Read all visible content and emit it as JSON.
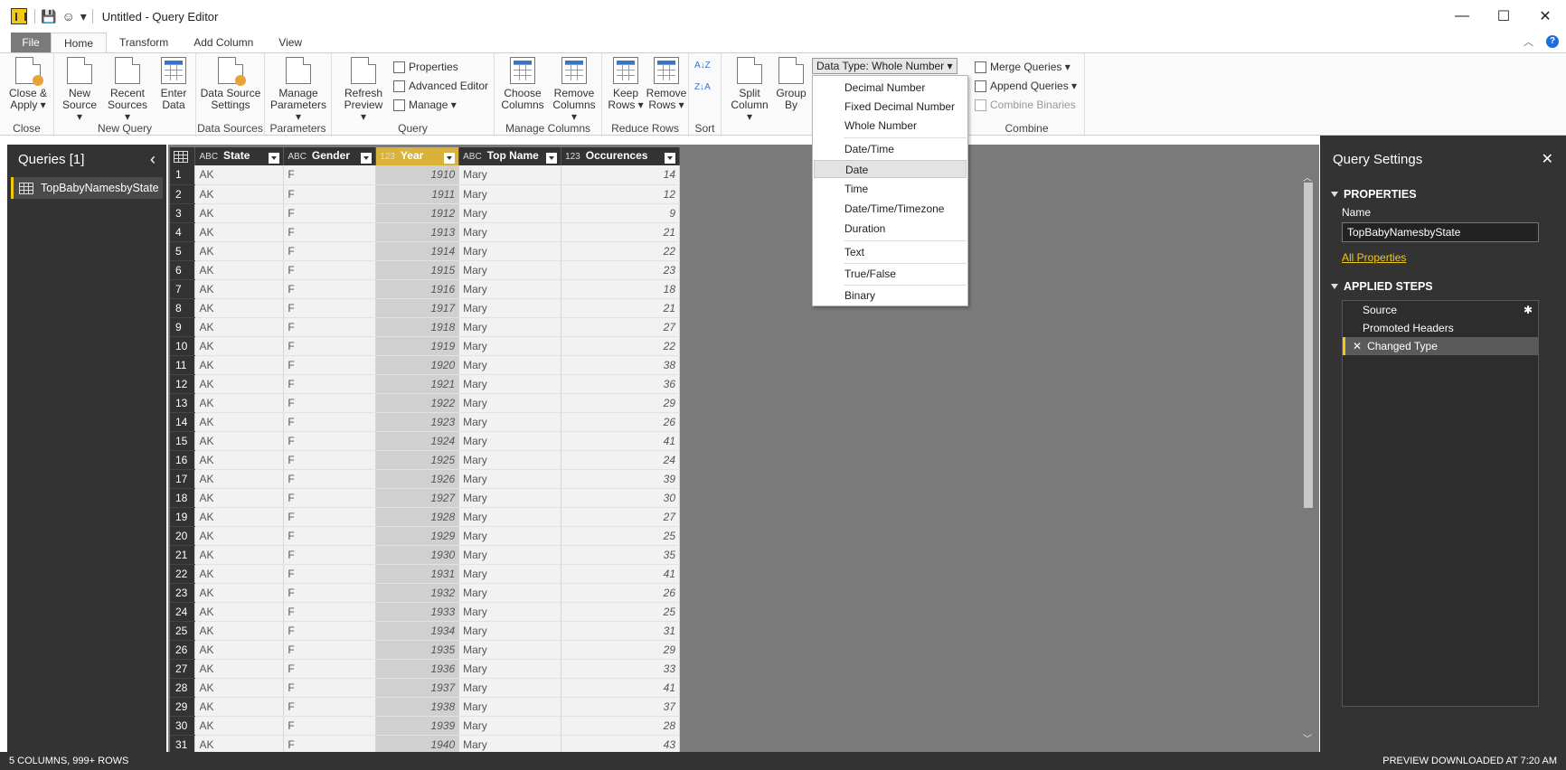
{
  "window": {
    "title": "Untitled - Query Editor",
    "minimize": "—",
    "maximize": "☐",
    "close": "✕"
  },
  "tabs": [
    {
      "label": "File"
    },
    {
      "label": "Home"
    },
    {
      "label": "Transform"
    },
    {
      "label": "Add Column"
    },
    {
      "label": "View"
    }
  ],
  "ribbon": {
    "close_group": {
      "label": "Close",
      "close_apply": "Close & Apply ▾"
    },
    "new_query": {
      "label": "New Query",
      "new_source": "New Source ▾",
      "recent_sources": "Recent Sources ▾",
      "enter_data": "Enter Data"
    },
    "data_sources": {
      "label": "Data Sources",
      "settings": "Data Source Settings"
    },
    "parameters": {
      "label": "Parameters",
      "manage": "Manage Parameters ▾"
    },
    "query": {
      "label": "Query",
      "refresh": "Refresh Preview ▾",
      "properties": "Properties",
      "advanced": "Advanced Editor",
      "manage": "Manage ▾"
    },
    "manage_columns": {
      "label": "Manage Columns",
      "choose": "Choose Columns",
      "remove": "Remove Columns ▾"
    },
    "reduce_rows": {
      "label": "Reduce Rows",
      "keep": "Keep Rows ▾",
      "remove": "Remove Rows ▾"
    },
    "sort": {
      "label": "Sort",
      "asc": "A↓Z",
      "desc": "Z↓A"
    },
    "transform": {
      "split": "Split Column ▾",
      "group": "Group By",
      "data_type": "Data Type: Whole Number ▾"
    },
    "combine": {
      "label": "Combine",
      "merge": "Merge Queries ▾",
      "append": "Append Queries ▾",
      "binaries": "Combine Binaries"
    }
  },
  "dtype_menu": [
    "Decimal Number",
    "Fixed Decimal Number",
    "Whole Number",
    "Date/Time",
    "Date",
    "Time",
    "Date/Time/Timezone",
    "Duration",
    "Text",
    "True/False",
    "Binary"
  ],
  "queries": {
    "title": "Queries [1]",
    "collapse": "‹",
    "items": [
      "TopBabyNamesbyState"
    ]
  },
  "table": {
    "columns": [
      {
        "type": "ABC",
        "name": "State"
      },
      {
        "type": "ABC",
        "name": "Gender"
      },
      {
        "type": "123",
        "name": "Year"
      },
      {
        "type": "ABC",
        "name": "Top Name"
      },
      {
        "type": "123",
        "name": "Occurences"
      }
    ],
    "rows": [
      [
        "1",
        "AK",
        "F",
        "1910",
        "Mary",
        "14"
      ],
      [
        "2",
        "AK",
        "F",
        "1911",
        "Mary",
        "12"
      ],
      [
        "3",
        "AK",
        "F",
        "1912",
        "Mary",
        "9"
      ],
      [
        "4",
        "AK",
        "F",
        "1913",
        "Mary",
        "21"
      ],
      [
        "5",
        "AK",
        "F",
        "1914",
        "Mary",
        "22"
      ],
      [
        "6",
        "AK",
        "F",
        "1915",
        "Mary",
        "23"
      ],
      [
        "7",
        "AK",
        "F",
        "1916",
        "Mary",
        "18"
      ],
      [
        "8",
        "AK",
        "F",
        "1917",
        "Mary",
        "21"
      ],
      [
        "9",
        "AK",
        "F",
        "1918",
        "Mary",
        "27"
      ],
      [
        "10",
        "AK",
        "F",
        "1919",
        "Mary",
        "22"
      ],
      [
        "11",
        "AK",
        "F",
        "1920",
        "Mary",
        "38"
      ],
      [
        "12",
        "AK",
        "F",
        "1921",
        "Mary",
        "36"
      ],
      [
        "13",
        "AK",
        "F",
        "1922",
        "Mary",
        "29"
      ],
      [
        "14",
        "AK",
        "F",
        "1923",
        "Mary",
        "26"
      ],
      [
        "15",
        "AK",
        "F",
        "1924",
        "Mary",
        "41"
      ],
      [
        "16",
        "AK",
        "F",
        "1925",
        "Mary",
        "24"
      ],
      [
        "17",
        "AK",
        "F",
        "1926",
        "Mary",
        "39"
      ],
      [
        "18",
        "AK",
        "F",
        "1927",
        "Mary",
        "30"
      ],
      [
        "19",
        "AK",
        "F",
        "1928",
        "Mary",
        "27"
      ],
      [
        "20",
        "AK",
        "F",
        "1929",
        "Mary",
        "25"
      ],
      [
        "21",
        "AK",
        "F",
        "1930",
        "Mary",
        "35"
      ],
      [
        "22",
        "AK",
        "F",
        "1931",
        "Mary",
        "41"
      ],
      [
        "23",
        "AK",
        "F",
        "1932",
        "Mary",
        "26"
      ],
      [
        "24",
        "AK",
        "F",
        "1933",
        "Mary",
        "25"
      ],
      [
        "25",
        "AK",
        "F",
        "1934",
        "Mary",
        "31"
      ],
      [
        "26",
        "AK",
        "F",
        "1935",
        "Mary",
        "29"
      ],
      [
        "27",
        "AK",
        "F",
        "1936",
        "Mary",
        "33"
      ],
      [
        "28",
        "AK",
        "F",
        "1937",
        "Mary",
        "41"
      ],
      [
        "29",
        "AK",
        "F",
        "1938",
        "Mary",
        "37"
      ],
      [
        "30",
        "AK",
        "F",
        "1939",
        "Mary",
        "28"
      ],
      [
        "31",
        "AK",
        "F",
        "1940",
        "Mary",
        "43"
      ]
    ]
  },
  "settings": {
    "title": "Query Settings",
    "close": "✕",
    "properties_title": "PROPERTIES",
    "name_label": "Name",
    "name_value": "TopBabyNamesbyState",
    "all_properties": "All Properties",
    "steps_title": "APPLIED STEPS",
    "steps": [
      "Source",
      "Promoted Headers",
      "Changed Type"
    ]
  },
  "status": {
    "left": "5 COLUMNS, 999+ ROWS",
    "right": "PREVIEW DOWNLOADED AT 7:20 AM"
  }
}
